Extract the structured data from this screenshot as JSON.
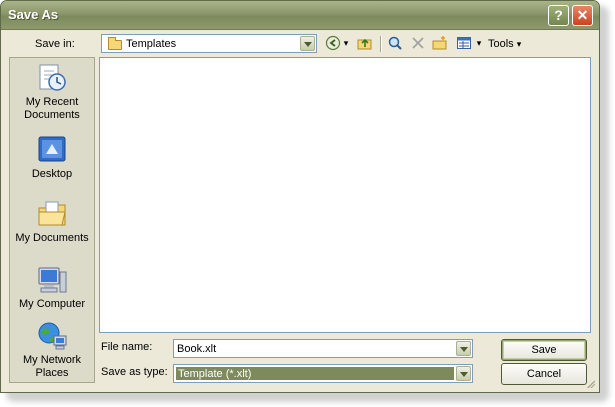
{
  "window": {
    "title": "Save As"
  },
  "titlebar": {
    "help_glyph": "?",
    "close_glyph": "✕"
  },
  "toolbar": {
    "save_in_label": "Save in:",
    "save_in_value": "Templates",
    "tools_label": "Tools",
    "tools_arrow": "▾",
    "back_arrow": "▾",
    "views_arrow": "▾"
  },
  "places": [
    {
      "label": "My Recent Documents",
      "icon": "recent-documents-icon"
    },
    {
      "label": "Desktop",
      "icon": "desktop-icon"
    },
    {
      "label": "My Documents",
      "icon": "my-documents-icon"
    },
    {
      "label": "My Computer",
      "icon": "my-computer-icon"
    },
    {
      "label": "My Network Places",
      "icon": "network-places-icon"
    }
  ],
  "form": {
    "file_name_label": "File name:",
    "file_name_value": "Book.xlt",
    "save_as_type_label": "Save as type:",
    "save_as_type_value": "Template (*.xlt)"
  },
  "buttons": {
    "save": "Save",
    "cancel": "Cancel"
  },
  "colors": {
    "accent": "#7c8a5c",
    "window_bg": "#ece9d8",
    "field_border": "#7f9db9"
  }
}
